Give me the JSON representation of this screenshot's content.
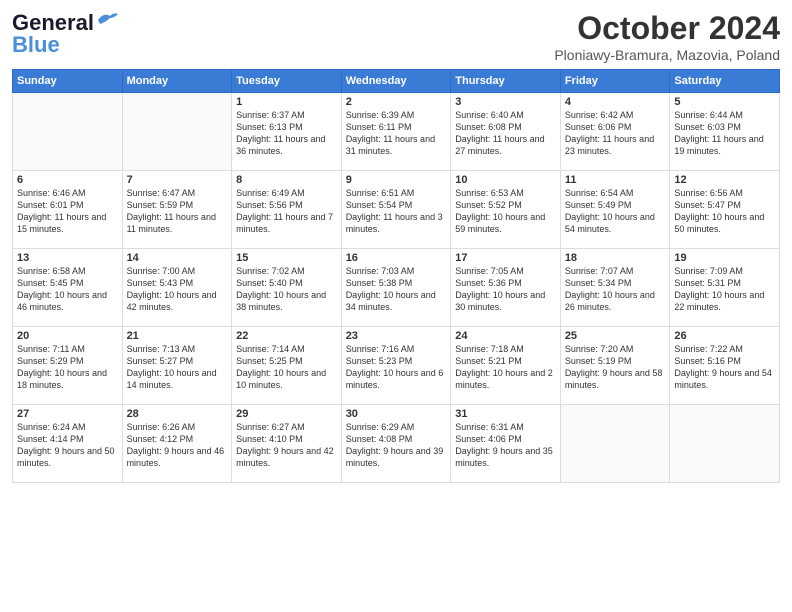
{
  "header": {
    "logo_general": "General",
    "logo_blue": "Blue",
    "month": "October 2024",
    "location": "Ploniawy-Bramura, Mazovia, Poland"
  },
  "days_of_week": [
    "Sunday",
    "Monday",
    "Tuesday",
    "Wednesday",
    "Thursday",
    "Friday",
    "Saturday"
  ],
  "weeks": [
    [
      {
        "day": "",
        "info": ""
      },
      {
        "day": "",
        "info": ""
      },
      {
        "day": "1",
        "info": "Sunrise: 6:37 AM\nSunset: 6:13 PM\nDaylight: 11 hours and 36 minutes."
      },
      {
        "day": "2",
        "info": "Sunrise: 6:39 AM\nSunset: 6:11 PM\nDaylight: 11 hours and 31 minutes."
      },
      {
        "day": "3",
        "info": "Sunrise: 6:40 AM\nSunset: 6:08 PM\nDaylight: 11 hours and 27 minutes."
      },
      {
        "day": "4",
        "info": "Sunrise: 6:42 AM\nSunset: 6:06 PM\nDaylight: 11 hours and 23 minutes."
      },
      {
        "day": "5",
        "info": "Sunrise: 6:44 AM\nSunset: 6:03 PM\nDaylight: 11 hours and 19 minutes."
      }
    ],
    [
      {
        "day": "6",
        "info": "Sunrise: 6:46 AM\nSunset: 6:01 PM\nDaylight: 11 hours and 15 minutes."
      },
      {
        "day": "7",
        "info": "Sunrise: 6:47 AM\nSunset: 5:59 PM\nDaylight: 11 hours and 11 minutes."
      },
      {
        "day": "8",
        "info": "Sunrise: 6:49 AM\nSunset: 5:56 PM\nDaylight: 11 hours and 7 minutes."
      },
      {
        "day": "9",
        "info": "Sunrise: 6:51 AM\nSunset: 5:54 PM\nDaylight: 11 hours and 3 minutes."
      },
      {
        "day": "10",
        "info": "Sunrise: 6:53 AM\nSunset: 5:52 PM\nDaylight: 10 hours and 59 minutes."
      },
      {
        "day": "11",
        "info": "Sunrise: 6:54 AM\nSunset: 5:49 PM\nDaylight: 10 hours and 54 minutes."
      },
      {
        "day": "12",
        "info": "Sunrise: 6:56 AM\nSunset: 5:47 PM\nDaylight: 10 hours and 50 minutes."
      }
    ],
    [
      {
        "day": "13",
        "info": "Sunrise: 6:58 AM\nSunset: 5:45 PM\nDaylight: 10 hours and 46 minutes."
      },
      {
        "day": "14",
        "info": "Sunrise: 7:00 AM\nSunset: 5:43 PM\nDaylight: 10 hours and 42 minutes."
      },
      {
        "day": "15",
        "info": "Sunrise: 7:02 AM\nSunset: 5:40 PM\nDaylight: 10 hours and 38 minutes."
      },
      {
        "day": "16",
        "info": "Sunrise: 7:03 AM\nSunset: 5:38 PM\nDaylight: 10 hours and 34 minutes."
      },
      {
        "day": "17",
        "info": "Sunrise: 7:05 AM\nSunset: 5:36 PM\nDaylight: 10 hours and 30 minutes."
      },
      {
        "day": "18",
        "info": "Sunrise: 7:07 AM\nSunset: 5:34 PM\nDaylight: 10 hours and 26 minutes."
      },
      {
        "day": "19",
        "info": "Sunrise: 7:09 AM\nSunset: 5:31 PM\nDaylight: 10 hours and 22 minutes."
      }
    ],
    [
      {
        "day": "20",
        "info": "Sunrise: 7:11 AM\nSunset: 5:29 PM\nDaylight: 10 hours and 18 minutes."
      },
      {
        "day": "21",
        "info": "Sunrise: 7:13 AM\nSunset: 5:27 PM\nDaylight: 10 hours and 14 minutes."
      },
      {
        "day": "22",
        "info": "Sunrise: 7:14 AM\nSunset: 5:25 PM\nDaylight: 10 hours and 10 minutes."
      },
      {
        "day": "23",
        "info": "Sunrise: 7:16 AM\nSunset: 5:23 PM\nDaylight: 10 hours and 6 minutes."
      },
      {
        "day": "24",
        "info": "Sunrise: 7:18 AM\nSunset: 5:21 PM\nDaylight: 10 hours and 2 minutes."
      },
      {
        "day": "25",
        "info": "Sunrise: 7:20 AM\nSunset: 5:19 PM\nDaylight: 9 hours and 58 minutes."
      },
      {
        "day": "26",
        "info": "Sunrise: 7:22 AM\nSunset: 5:16 PM\nDaylight: 9 hours and 54 minutes."
      }
    ],
    [
      {
        "day": "27",
        "info": "Sunrise: 6:24 AM\nSunset: 4:14 PM\nDaylight: 9 hours and 50 minutes."
      },
      {
        "day": "28",
        "info": "Sunrise: 6:26 AM\nSunset: 4:12 PM\nDaylight: 9 hours and 46 minutes."
      },
      {
        "day": "29",
        "info": "Sunrise: 6:27 AM\nSunset: 4:10 PM\nDaylight: 9 hours and 42 minutes."
      },
      {
        "day": "30",
        "info": "Sunrise: 6:29 AM\nSunset: 4:08 PM\nDaylight: 9 hours and 39 minutes."
      },
      {
        "day": "31",
        "info": "Sunrise: 6:31 AM\nSunset: 4:06 PM\nDaylight: 9 hours and 35 minutes."
      },
      {
        "day": "",
        "info": ""
      },
      {
        "day": "",
        "info": ""
      }
    ]
  ]
}
